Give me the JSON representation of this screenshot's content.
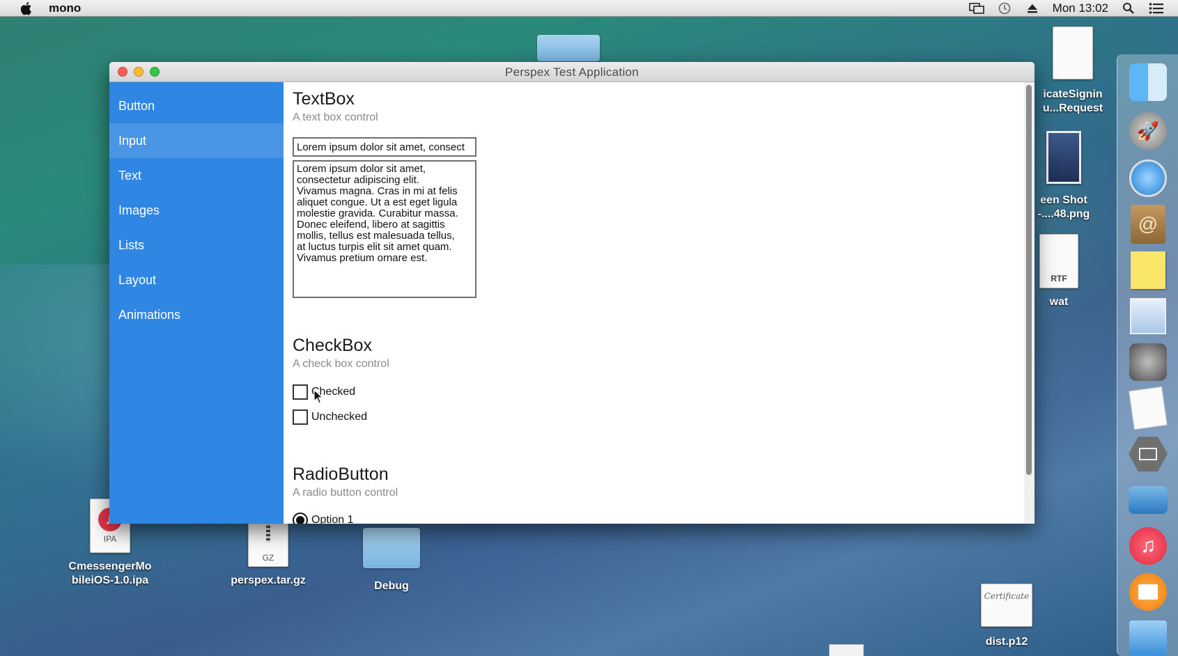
{
  "menubar": {
    "app_name": "mono",
    "clock": "Mon 13:02",
    "icons": [
      "apple-icon",
      "screen-mirror-icon",
      "time-machine-icon",
      "eject-icon",
      "spotlight-search-icon",
      "notification-list-icon"
    ]
  },
  "window": {
    "title": "Perspex Test Application"
  },
  "sidebar": {
    "items": [
      {
        "label": "Button"
      },
      {
        "label": "Input"
      },
      {
        "label": "Text"
      },
      {
        "label": "Images"
      },
      {
        "label": "Lists"
      },
      {
        "label": "Layout"
      },
      {
        "label": "Animations"
      }
    ],
    "active_index": 1
  },
  "textbox_section": {
    "title": "TextBox",
    "subtitle": "A text box control",
    "single_line_value": "Lorem ipsum dolor sit amet, consect",
    "multi_line_value": "Lorem ipsum dolor sit amet,\nconsectetur adipiscing elit.\nVivamus magna. Cras in mi at felis\naliquet congue. Ut a est eget ligula\nmolestie gravida. Curabitur massa.\nDonec eleifend, libero at sagittis\nmollis, tellus est malesuada tellus,\nat luctus turpis elit sit amet quam.\nVivamus pretium ornare est."
  },
  "checkbox_section": {
    "title": "CheckBox",
    "subtitle": "A check box control",
    "items": [
      {
        "label": "Checked",
        "checked": false
      },
      {
        "label": "Unchecked",
        "checked": false
      }
    ]
  },
  "radio_section": {
    "title": "RadioButton",
    "subtitle": "A radio button control",
    "items": [
      {
        "label": "Option 1",
        "selected": true
      }
    ]
  },
  "desktop": {
    "items": [
      {
        "label_line1": "icateSignin",
        "label_line2": "u...Request",
        "icon": "document-icon"
      },
      {
        "label_line1": "een Shot",
        "label_line2": "-....48.png",
        "icon": "screenshot-icon"
      },
      {
        "label_line1": "wat",
        "badge": "RTF",
        "icon": "rtf-document-icon"
      },
      {
        "label_line1": "CmessengerMo",
        "label_line2": "bileiOS-1.0.ipa",
        "badge": "IPA",
        "icon": "ipa-file-icon"
      },
      {
        "label_line1": "perspex.tar.gz",
        "badge": "GZ",
        "icon": "archive-icon"
      },
      {
        "label_line1": "Debug",
        "icon": "folder-icon"
      },
      {
        "label_line1": "dist.p12",
        "badge": "Certificate",
        "icon": "certificate-icon"
      }
    ]
  },
  "dock": {
    "items": [
      "finder-icon",
      "launchpad-icon",
      "safari-icon",
      "contacts-icon",
      "stickies-icon",
      "preview-icon",
      "system-preferences-icon",
      "textedit-icon",
      "display-icon",
      "migration-icon",
      "itunes-icon",
      "ibooks-icon",
      "xcode-icon"
    ]
  },
  "colors": {
    "sidebar_bg": "#2f86e3",
    "sidebar_active": "#4a95e6"
  }
}
